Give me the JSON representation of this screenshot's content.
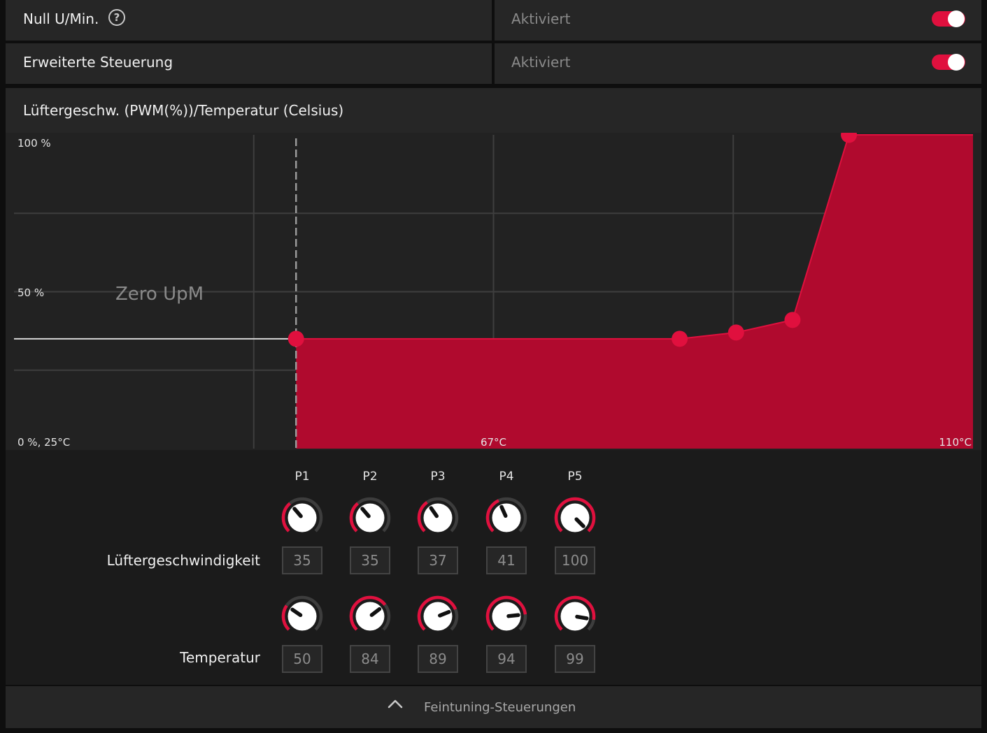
{
  "settings": [
    {
      "label": "Null U/Min.",
      "value": "Aktiviert",
      "enabled": true,
      "has_help": true,
      "help_glyph": "?"
    },
    {
      "label": "Erweiterte Steuerung",
      "value": "Aktiviert",
      "enabled": true,
      "has_help": false
    }
  ],
  "colors": {
    "accent": "#e0103e",
    "fill": "#b00a2e"
  },
  "chart_data": {
    "type": "area",
    "title": "Lüftergeschw. (PWM(%))/Temperatur (Celsius)",
    "x_unit": "°C",
    "y_unit": "%",
    "xlim": [
      25,
      110
    ],
    "ylim": [
      0,
      100
    ],
    "y_tick_labels": [
      "100 %",
      "50 %",
      "0 %, 25°C"
    ],
    "x_tick_labels": [
      "67°C",
      "110°C"
    ],
    "zero_rpm_label": "Zero UpM",
    "zero_rpm_threshold": 50,
    "grid": true,
    "points": [
      {
        "name": "P1",
        "x": 50,
        "y": 35
      },
      {
        "name": "P2",
        "x": 84,
        "y": 35
      },
      {
        "name": "P3",
        "x": 89,
        "y": 37
      },
      {
        "name": "P4",
        "x": 94,
        "y": 41
      },
      {
        "name": "P5",
        "x": 99,
        "y": 100
      }
    ]
  },
  "tuning": {
    "fan_speed_label": "Lüftergeschwindigkeit",
    "temperature_label": "Temperatur",
    "fan_speed_range": [
      0,
      100
    ],
    "temperature_range": [
      25,
      110
    ]
  },
  "footer": {
    "label": "Feintuning-Steuerungen",
    "icon": "chevron-up-icon"
  }
}
